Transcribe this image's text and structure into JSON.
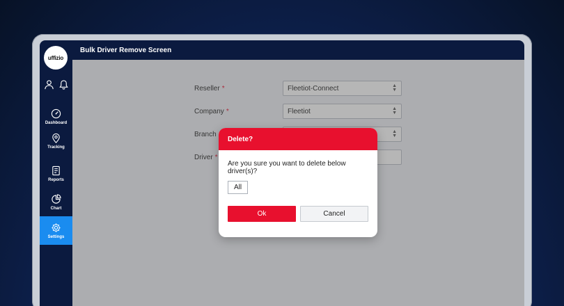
{
  "app": {
    "logo_text": "uffizio"
  },
  "header": {
    "title": "Bulk Driver Remove Screen"
  },
  "sidebar": {
    "top_icons": [
      "user-icon",
      "bell-icon"
    ],
    "items": [
      {
        "label": "Dashboard",
        "icon": "speedometer-icon"
      },
      {
        "label": "Tracking",
        "icon": "map-pin-icon"
      },
      {
        "label": "Reports",
        "icon": "report-icon"
      },
      {
        "label": "Chart",
        "icon": "pie-chart-icon"
      },
      {
        "label": "Settings",
        "icon": "gear-icon",
        "active": true
      }
    ]
  },
  "form": {
    "reseller": {
      "label": "Reseller",
      "value": "Fleetiot-Connect"
    },
    "company": {
      "label": "Company",
      "value": "Fleetiot"
    },
    "branch": {
      "label": "Branch",
      "value": ""
    },
    "driver": {
      "label": "Driver",
      "value": ""
    },
    "required_mark": "*"
  },
  "modal": {
    "title": "Delete?",
    "message": "Are you sure you want to delete below driver(s)?",
    "selection": "All",
    "ok_label": "Ok",
    "cancel_label": "Cancel"
  },
  "colors": {
    "accent": "#e8102e",
    "nav_bg": "#0b1a3f",
    "active_nav": "#1a8cf0"
  }
}
